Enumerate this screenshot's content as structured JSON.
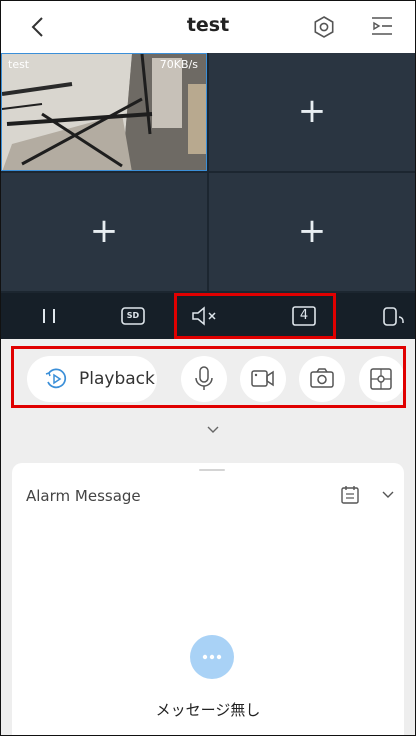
{
  "header": {
    "title": "test",
    "back_icon": "chevron-left-icon",
    "settings_icon": "settings-icon",
    "menu_icon": "playlist-menu-icon"
  },
  "video": {
    "channel_name": "test",
    "bitrate": "70KB/s",
    "empty_slot_symbol": "+"
  },
  "control_bar": {
    "pause_icon": "pause-icon",
    "quality_label": "SD",
    "mute_icon": "speaker-muted-icon",
    "split_count": "4",
    "fullscreen_icon": "rotate-screen-icon"
  },
  "actions": {
    "playback_label": "Playback",
    "icons": [
      "playback-icon",
      "microphone-icon",
      "record-icon",
      "camera-snapshot-icon",
      "ptz-icon"
    ]
  },
  "alarm": {
    "title": "Alarm Message",
    "empty_message": "メッセージ無し",
    "calendar_icon": "calendar-icon",
    "collapse_icon": "chevron-down-icon"
  },
  "colors": {
    "grid_bg": "#1c2630",
    "cell_bg": "#2a3541",
    "control_bar_bg": "#161f28",
    "highlight": "#e00000",
    "accent_blue": "#3b8fd8",
    "bubble": "#a9d2f6"
  }
}
